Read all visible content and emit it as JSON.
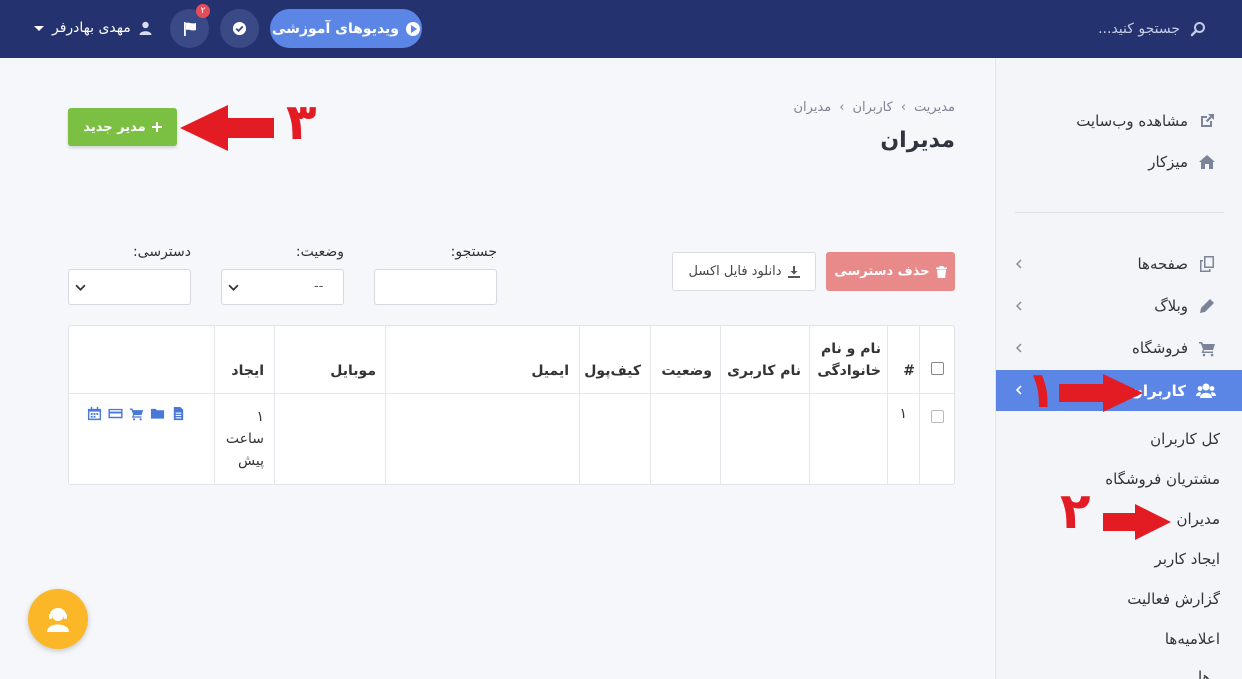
{
  "topbar": {
    "search_placeholder": "جستجو کنید...",
    "videos_button": "ویدیوهای آموزشی",
    "notif_count": "۲",
    "user_name": "مهدی بهادرفر"
  },
  "sidebar": {
    "top_items": [
      {
        "label": "مشاهده وب‌سایت",
        "icon": "external-link-icon"
      },
      {
        "label": "میزکار",
        "icon": "home-icon"
      }
    ],
    "menu_items": [
      {
        "label": "صفحه‌ها",
        "icon": "pages-icon"
      },
      {
        "label": "وبلاگ",
        "icon": "pencil-icon"
      },
      {
        "label": "فروشگاه",
        "icon": "cart-icon"
      },
      {
        "label": "کاربران",
        "icon": "users-icon",
        "active": true
      }
    ],
    "sub_items": [
      "کل کاربران",
      "مشتریان فروشگاه",
      "مدیران",
      "ایجاد کاربر",
      "گزارش فعالیت",
      "اعلامیه‌ها",
      "..ها"
    ]
  },
  "breadcrumb": [
    "مدیریت",
    "کاربران",
    "مدیران"
  ],
  "breadcrumb_sep": "›",
  "page_title": "مدیران",
  "buttons": {
    "new_admin": "مدیر جدید",
    "delete_access": "حذف دسترسی",
    "download_excel": "دانلود فایل اکسل"
  },
  "filters": {
    "search_label": "جستجو:",
    "status_label": "وضعیت:",
    "status_value": "--",
    "access_label": "دسترسی:"
  },
  "table": {
    "headers": {
      "number": "#",
      "full_name": "نام و نام خانوادگی",
      "username": "نام کاربری",
      "status": "وضعیت",
      "wallet": "کیف‌پول",
      "email": "ایمیل",
      "mobile": "موبایل",
      "created": "ایجاد"
    },
    "rows": [
      {
        "number": "۱",
        "created_line1": "۱",
        "created_line2": "ساعت",
        "created_line3": "پیش"
      }
    ]
  },
  "annotations": {
    "step1": "۱",
    "step2": "۲",
    "step3": "۳"
  },
  "colors": {
    "topbar": "#243370",
    "accent": "#5b86e5",
    "success": "#7bc043",
    "danger": "#e88a8a",
    "annotation": "#e31b23"
  }
}
